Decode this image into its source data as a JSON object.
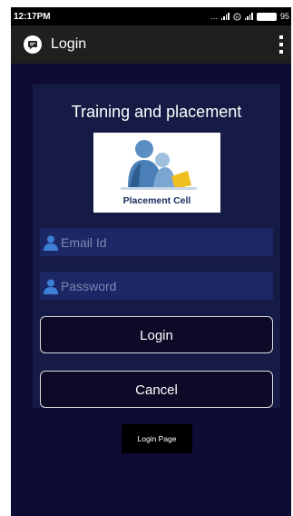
{
  "status_bar": {
    "time": "12:17PM",
    "dots": "...",
    "battery_text": "95"
  },
  "app_bar": {
    "title": "Login",
    "app_icon": "chat-icon",
    "menu_icon": "overflow-menu-icon"
  },
  "form": {
    "heading": "Training and placement",
    "logo_caption": "Placement Cell",
    "email": {
      "placeholder": "Email Id",
      "value": "",
      "icon": "user-icon"
    },
    "password": {
      "placeholder": "Password",
      "value": "",
      "icon": "user-icon"
    },
    "login_label": "Login",
    "cancel_label": "Cancel"
  },
  "page_badge": "Login Page",
  "colors": {
    "background": "#0e0c34",
    "card": "#151b45",
    "field": "#1c2766",
    "app_bar": "#1f1f1f"
  }
}
